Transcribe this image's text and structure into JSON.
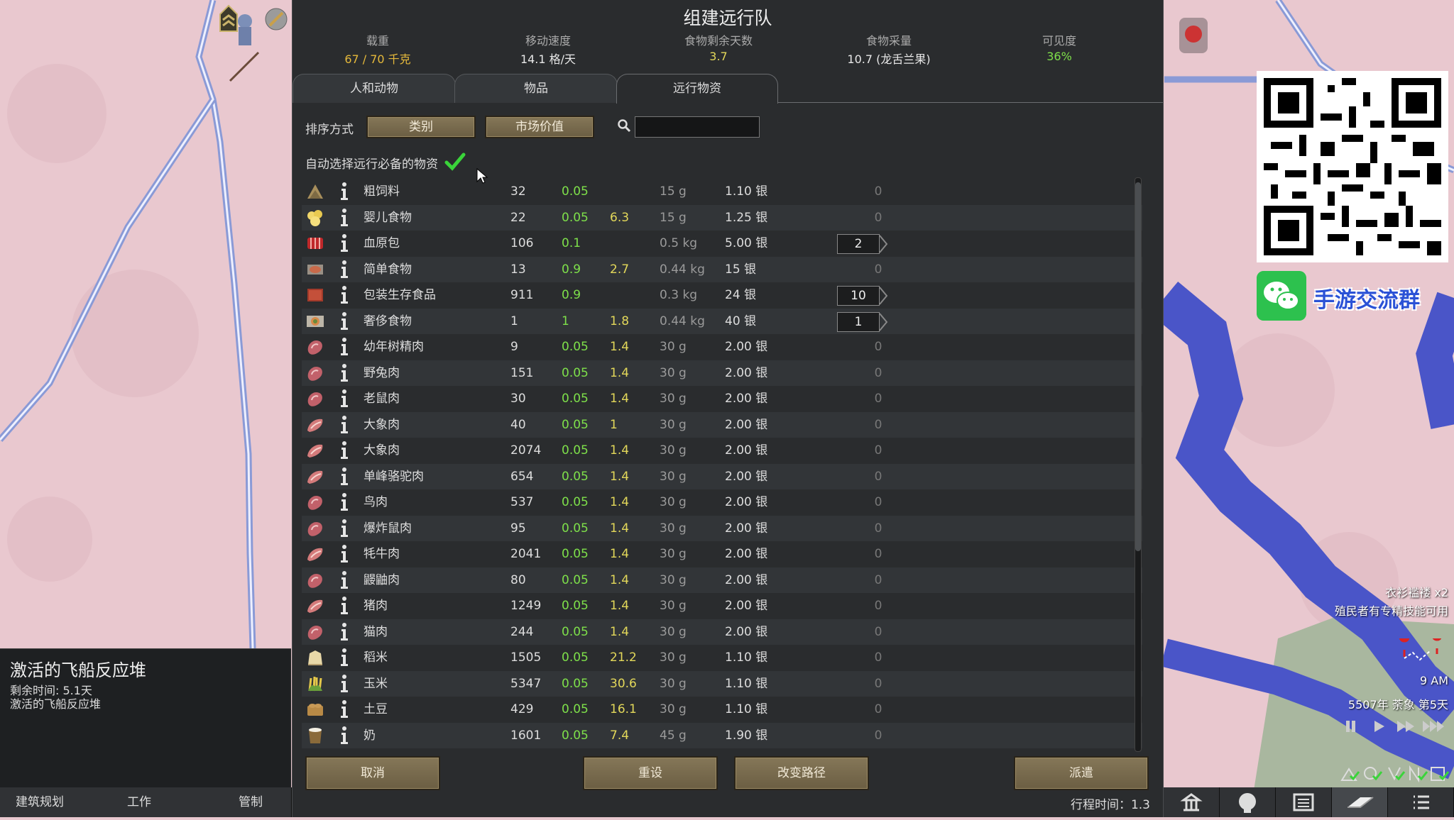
{
  "dialog": {
    "title": "组建远行队",
    "stats": [
      {
        "label": "载重",
        "value": "67 / 70 千克",
        "color": "#e5b93b"
      },
      {
        "label": "移动速度",
        "value": "14.1 格/天",
        "color": "#e8e8e8"
      },
      {
        "label": "食物剩余天数",
        "value": "3.7",
        "color": "#e3d85a"
      },
      {
        "label": "食物采量",
        "value": "10.7 (龙舌兰果)",
        "color": "#e8e8e8"
      },
      {
        "label": "可见度",
        "value": "36%",
        "color": "#7ee04a"
      }
    ],
    "tabs": [
      "人和动物",
      "物品",
      "远行物资"
    ],
    "active_tab": 2,
    "sort_label": "排序方式",
    "sort_buttons": [
      "类别",
      "市场价值"
    ],
    "search_placeholder": "",
    "auto_select_label": "自动选择远行必备的物资",
    "auto_select_checked": true,
    "buttons": {
      "cancel": "取消",
      "reset": "重设",
      "change_route": "改变路径",
      "send": "派遣"
    },
    "travel_time": "行程时间：1.3"
  },
  "items": [
    {
      "icon": "kibble",
      "name": "粗饲料",
      "count": "32",
      "mass": "0.05",
      "days": "",
      "weight": "15 g",
      "value": "1.10 银",
      "qty": "0"
    },
    {
      "icon": "baby-food",
      "name": "婴儿食物",
      "count": "22",
      "mass": "0.05",
      "days": "6.3",
      "weight": "15 g",
      "value": "1.25 银",
      "qty": "0"
    },
    {
      "icon": "hemogen",
      "name": "血原包",
      "count": "106",
      "mass": "0.1",
      "days": "",
      "weight": "0.5 kg",
      "value": "5.00 银",
      "qty": "2"
    },
    {
      "icon": "simple-meal",
      "name": "简单食物",
      "count": "13",
      "mass": "0.9",
      "days": "2.7",
      "weight": "0.44 kg",
      "value": "15 银",
      "qty": "0"
    },
    {
      "icon": "survival-meal",
      "name": "包装生存食品",
      "count": "911",
      "mass": "0.9",
      "days": "",
      "weight": "0.3 kg",
      "value": "24 银",
      "qty": "10"
    },
    {
      "icon": "lavish-meal",
      "name": "奢侈食物",
      "count": "1",
      "mass": "1",
      "days": "1.8",
      "weight": "0.44 kg",
      "value": "40 银",
      "qty": "1"
    },
    {
      "icon": "raw-meat",
      "name": "幼年树精肉",
      "count": "9",
      "mass": "0.05",
      "days": "1.4",
      "weight": "30 g",
      "value": "2.00 银",
      "qty": "0"
    },
    {
      "icon": "raw-meat",
      "name": "野兔肉",
      "count": "151",
      "mass": "0.05",
      "days": "1.4",
      "weight": "30 g",
      "value": "2.00 银",
      "qty": "0"
    },
    {
      "icon": "raw-meat",
      "name": "老鼠肉",
      "count": "30",
      "mass": "0.05",
      "days": "1.4",
      "weight": "30 g",
      "value": "2.00 银",
      "qty": "0"
    },
    {
      "icon": "steak",
      "name": "大象肉",
      "count": "40",
      "mass": "0.05",
      "days": "1",
      "weight": "30 g",
      "value": "2.00 银",
      "qty": "0"
    },
    {
      "icon": "steak",
      "name": "大象肉",
      "count": "2074",
      "mass": "0.05",
      "days": "1.4",
      "weight": "30 g",
      "value": "2.00 银",
      "qty": "0"
    },
    {
      "icon": "steak",
      "name": "单峰骆驼肉",
      "count": "654",
      "mass": "0.05",
      "days": "1.4",
      "weight": "30 g",
      "value": "2.00 银",
      "qty": "0"
    },
    {
      "icon": "raw-meat",
      "name": "鸟肉",
      "count": "537",
      "mass": "0.05",
      "days": "1.4",
      "weight": "30 g",
      "value": "2.00 银",
      "qty": "0"
    },
    {
      "icon": "raw-meat",
      "name": "爆炸鼠肉",
      "count": "95",
      "mass": "0.05",
      "days": "1.4",
      "weight": "30 g",
      "value": "2.00 银",
      "qty": "0"
    },
    {
      "icon": "steak",
      "name": "牦牛肉",
      "count": "2041",
      "mass": "0.05",
      "days": "1.4",
      "weight": "30 g",
      "value": "2.00 银",
      "qty": "0"
    },
    {
      "icon": "raw-meat",
      "name": "鼹鼬肉",
      "count": "80",
      "mass": "0.05",
      "days": "1.4",
      "weight": "30 g",
      "value": "2.00 银",
      "qty": "0"
    },
    {
      "icon": "steak",
      "name": "猪肉",
      "count": "1249",
      "mass": "0.05",
      "days": "1.4",
      "weight": "30 g",
      "value": "2.00 银",
      "qty": "0"
    },
    {
      "icon": "raw-meat",
      "name": "猫肉",
      "count": "244",
      "mass": "0.05",
      "days": "1.4",
      "weight": "30 g",
      "value": "2.00 银",
      "qty": "0"
    },
    {
      "icon": "rice",
      "name": "稻米",
      "count": "1505",
      "mass": "0.05",
      "days": "21.2",
      "weight": "30 g",
      "value": "1.10 银",
      "qty": "0"
    },
    {
      "icon": "corn",
      "name": "玉米",
      "count": "5347",
      "mass": "0.05",
      "days": "30.6",
      "weight": "30 g",
      "value": "1.10 银",
      "qty": "0"
    },
    {
      "icon": "potato",
      "name": "土豆",
      "count": "429",
      "mass": "0.05",
      "days": "16.1",
      "weight": "30 g",
      "value": "1.10 银",
      "qty": "0"
    },
    {
      "icon": "milk",
      "name": "奶",
      "count": "1601",
      "mass": "0.05",
      "days": "7.4",
      "weight": "45 g",
      "value": "1.90 银",
      "qty": "0"
    }
  ],
  "alert": {
    "title": "激活的飞船反应堆",
    "remaining": "剩余时间: 5.1天",
    "detail": "激活的飞船反应堆"
  },
  "bottom_bar": [
    "建筑规划",
    "工作",
    "管制"
  ],
  "overlay": {
    "group_label": "手游交流群"
  },
  "hud": {
    "notice1": "衣衫褴褛 x2",
    "notice2": "殖民者有专精技能可用",
    "time": "9 AM",
    "date": "5507年 荼象 第5天"
  }
}
